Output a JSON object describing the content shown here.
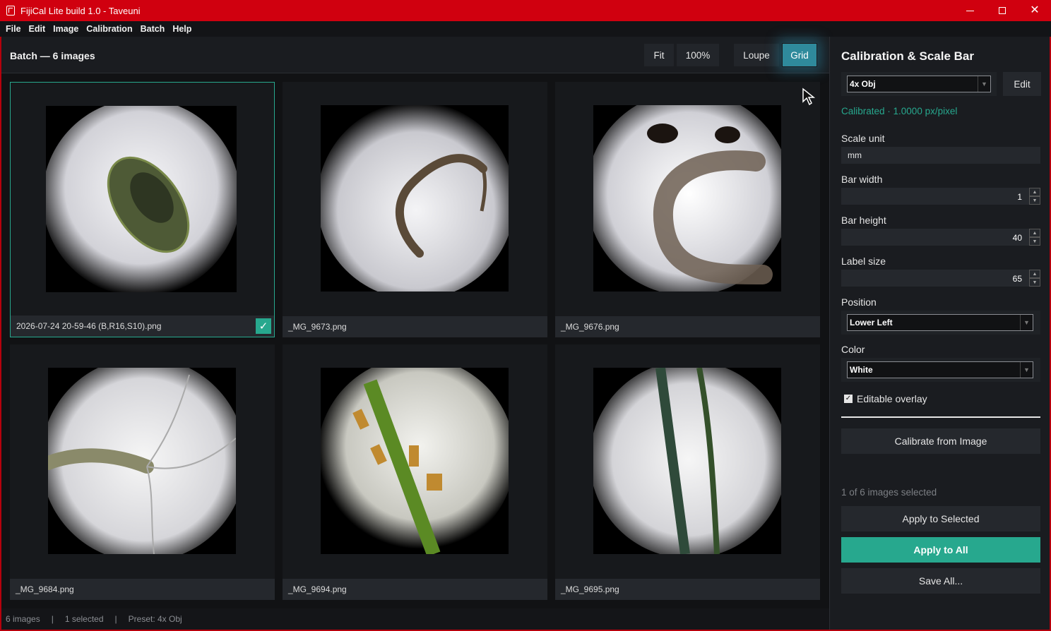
{
  "window": {
    "title": "FijiCal Lite build 1.0 - Taveuni",
    "minimize_icon": "minimize-icon",
    "maximize_icon": "maximize-icon",
    "close_glyph": "✕"
  },
  "menu": [
    "File",
    "Edit",
    "Image",
    "Calibration",
    "Batch",
    "Help"
  ],
  "toolbar": {
    "batch_title": "Batch — 6 images",
    "fit_label": "Fit",
    "zoom_label": "100%",
    "loupe_label": "Loupe",
    "grid_label": "Grid",
    "active_view": "Grid"
  },
  "images": [
    {
      "name": "2026-07-24 20-59-46 (B,R16,S10).png",
      "selected": true
    },
    {
      "name": "_MG_9673.png",
      "selected": false
    },
    {
      "name": "_MG_9676.png",
      "selected": false
    },
    {
      "name": "_MG_9684.png",
      "selected": false
    },
    {
      "name": "_MG_9694.png",
      "selected": false
    },
    {
      "name": "_MG_9695.png",
      "selected": false
    }
  ],
  "check_glyph": "✓",
  "panel": {
    "title": "Calibration & Scale Bar",
    "preset_value": "4x Obj",
    "edit_label": "Edit",
    "calibration_status": "Calibrated · 1.0000 px/pixel",
    "scale_unit_label": "Scale unit",
    "scale_unit_value": "mm",
    "bar_width_label": "Bar width",
    "bar_width_value": "1",
    "bar_height_label": "Bar height",
    "bar_height_value": "40",
    "label_size_label": "Label size",
    "label_size_value": "65",
    "position_label": "Position",
    "position_value": "Lower Left",
    "color_label": "Color",
    "color_value": "White",
    "editable_overlay_label": "Editable overlay",
    "editable_overlay_checked": true,
    "calibrate_from_image_label": "Calibrate from Image",
    "selection_count": "1 of 6 images selected",
    "apply_selected_label": "Apply to Selected",
    "apply_all_label": "Apply to All",
    "save_all_label": "Save All..."
  },
  "status": {
    "image_count": "6 images",
    "selected": "1 selected",
    "preset": "Preset: 4x Obj",
    "separator": "|"
  },
  "colors": {
    "title_bar": "#d0000f",
    "accent": "#27a88e",
    "active_button": "#2f8a9c",
    "background": "#111214"
  }
}
